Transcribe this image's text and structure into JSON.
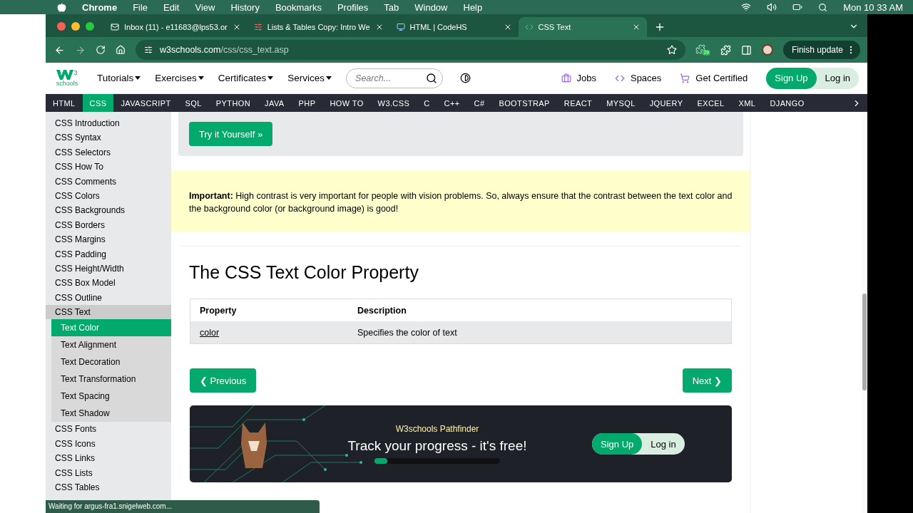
{
  "menubar": {
    "app": "Chrome",
    "items": [
      "File",
      "Edit",
      "View",
      "History",
      "Bookmarks",
      "Profiles",
      "Tab",
      "Window",
      "Help"
    ],
    "clock": "Mon 10 33 AM"
  },
  "tabs": [
    {
      "title": "Inbox (11) - e11683@lps53.or",
      "selected": false
    },
    {
      "title": "Lists & Tables Copy: Intro We",
      "selected": false
    },
    {
      "title": "HTML | CodeHS",
      "selected": false
    },
    {
      "title": "CSS Text",
      "selected": true
    }
  ],
  "address_bar": {
    "url_host": "w3schools.com",
    "url_path": "/css/css_text.asp",
    "extension_badge": "29",
    "update_button": "Finish update"
  },
  "site_header": {
    "logo_sup": "3",
    "logo_text": "schools",
    "menus": [
      "Tutorials",
      "Exercises",
      "Certificates",
      "Services"
    ],
    "search": {
      "placeholder": "Search..."
    },
    "links": [
      {
        "kind": "jobs",
        "label": "Jobs"
      },
      {
        "kind": "spaces",
        "label": "Spaces"
      },
      {
        "kind": "cart",
        "label": "Get Certified"
      }
    ],
    "sign_up": "Sign Up",
    "log_in": "Log in"
  },
  "topnav": [
    {
      "label": "HTML",
      "selected": false
    },
    {
      "label": "CSS",
      "selected": true
    },
    {
      "label": "JAVASCRIPT",
      "selected": false
    },
    {
      "label": "SQL",
      "selected": false
    },
    {
      "label": "PYTHON",
      "selected": false
    },
    {
      "label": "JAVA",
      "selected": false
    },
    {
      "label": "PHP",
      "selected": false
    },
    {
      "label": "HOW TO",
      "selected": false
    },
    {
      "label": "W3.CSS",
      "selected": false
    },
    {
      "label": "C",
      "selected": false
    },
    {
      "label": "C++",
      "selected": false
    },
    {
      "label": "C#",
      "selected": false
    },
    {
      "label": "BOOTSTRAP",
      "selected": false
    },
    {
      "label": "REACT",
      "selected": false
    },
    {
      "label": "MYSQL",
      "selected": false
    },
    {
      "label": "JQUERY",
      "selected": false
    },
    {
      "label": "EXCEL",
      "selected": false
    },
    {
      "label": "XML",
      "selected": false
    },
    {
      "label": "DJANGO",
      "selected": false
    }
  ],
  "sidebar": [
    {
      "label": "CSS Introduction",
      "selected": false
    },
    {
      "label": "CSS Syntax",
      "selected": false
    },
    {
      "label": "CSS Selectors",
      "selected": false
    },
    {
      "label": "CSS How To",
      "selected": false
    },
    {
      "label": "CSS Comments",
      "selected": false
    },
    {
      "label": "CSS Colors",
      "selected": false
    },
    {
      "label": "CSS Backgrounds",
      "selected": false
    },
    {
      "label": "CSS Borders",
      "selected": false
    },
    {
      "label": "CSS Margins",
      "selected": false
    },
    {
      "label": "CSS Padding",
      "selected": false
    },
    {
      "label": "CSS Height/Width",
      "selected": false
    },
    {
      "label": "CSS Box Model",
      "selected": false
    },
    {
      "label": "CSS Outline",
      "selected": false
    },
    {
      "label": "CSS Text",
      "selected": true,
      "expanded": true,
      "children": [
        {
          "label": "Text Color",
          "selected": true
        },
        {
          "label": "Text Alignment",
          "selected": false
        },
        {
          "label": "Text Decoration",
          "selected": false
        },
        {
          "label": "Text Transformation",
          "selected": false
        },
        {
          "label": "Text Spacing",
          "selected": false
        },
        {
          "label": "Text Shadow",
          "selected": false
        }
      ]
    },
    {
      "label": "CSS Fonts",
      "selected": false
    },
    {
      "label": "CSS Icons",
      "selected": false
    },
    {
      "label": "CSS Links",
      "selected": false
    },
    {
      "label": "CSS Lists",
      "selected": false
    },
    {
      "label": "CSS Tables",
      "selected": false
    }
  ],
  "main": {
    "try_button": "Try it Yourself »",
    "note": "**Important:** High contrast is very important for people with vision problems. So, always ensure that the contrast between the text color and the background color (or background image) is good!",
    "heading": "The CSS Text Color Property",
    "table": {
      "columns": [
        "Property",
        "Description"
      ],
      "rows": [
        {
          "property": "color",
          "description": "Specifies the color of text"
        }
      ]
    },
    "previous": "❮ Previous",
    "next": "Next ❯"
  },
  "banner": {
    "subtitle": "W3schools Pathfinder",
    "title": "Track your progress - it's free!",
    "progress": {
      "level": 0.1
    },
    "sign_up": "Sign Up",
    "log_in": "Log in"
  },
  "status_bar": "Waiting for argus-fra1.snigelweb.com..."
}
